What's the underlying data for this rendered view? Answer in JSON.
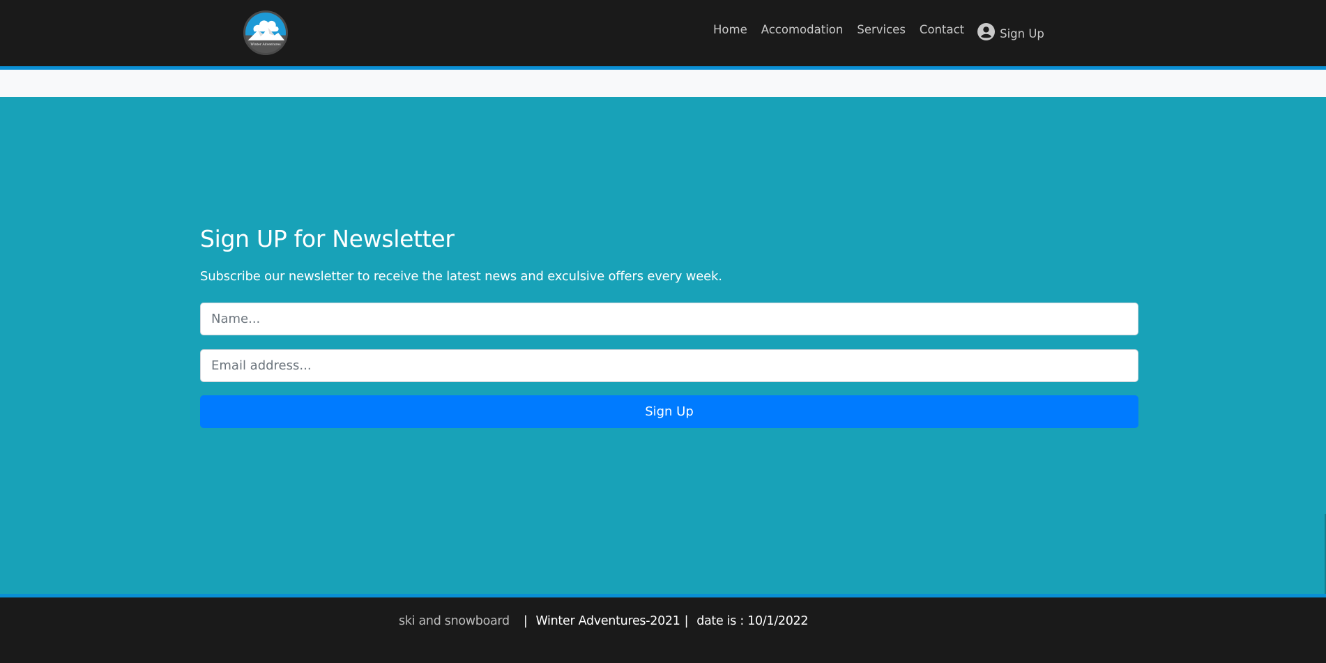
{
  "header": {
    "logo_alt": "Winter Adventures",
    "nav": [
      {
        "label": "Home"
      },
      {
        "label": "Accomodation"
      },
      {
        "label": "Services"
      },
      {
        "label": "Contact"
      }
    ],
    "signup": {
      "icon": "user-circle-icon",
      "label": "Sign Up"
    }
  },
  "newsletter": {
    "title": "Sign UP for Newsletter",
    "subtitle": "Subscribe our newsletter to receive the latest news and exculsive offers every week.",
    "name_field": {
      "value": "",
      "placeholder": "Name..."
    },
    "email_field": {
      "value": "",
      "placeholder": "Email address..."
    },
    "submit_label": "Sign Up"
  },
  "footer": {
    "tagline": "ski and snowboard",
    "separator": "|",
    "brand": "Winter Adventures-2021",
    "date_text": "date is : 10/1/2022"
  },
  "colors": {
    "header_bg": "#1a1a1a",
    "accent_line": "#0a8fd4",
    "section_bg": "#18a2b8",
    "button_bg": "#007bff",
    "light_strip": "#f8f9fa"
  }
}
